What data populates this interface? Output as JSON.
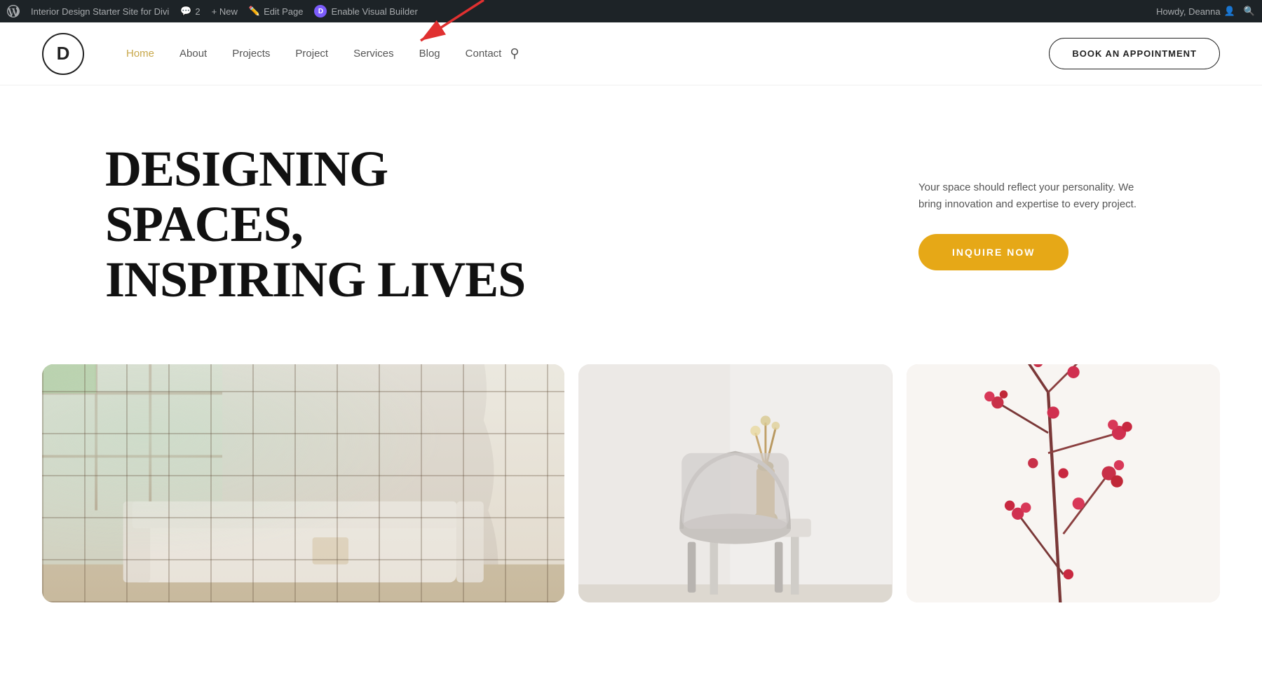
{
  "adminBar": {
    "siteTitle": "Interior Design Starter Site for Divi",
    "commentsCount": "2",
    "newLabel": "+ New",
    "editPageLabel": "Edit Page",
    "enableVisualBuilder": "Enable Visual Builder",
    "howdy": "Howdy, Deanna"
  },
  "nav": {
    "logoLetter": "D",
    "links": [
      {
        "label": "Home",
        "active": true
      },
      {
        "label": "About",
        "active": false
      },
      {
        "label": "Projects",
        "active": false
      },
      {
        "label": "Project",
        "active": false
      },
      {
        "label": "Services",
        "active": false
      },
      {
        "label": "Blog",
        "active": false
      },
      {
        "label": "Contact",
        "active": false
      }
    ],
    "bookButton": "BOOK AN APPOINTMENT"
  },
  "hero": {
    "titleLine1": "DESIGNING SPACES,",
    "titleLine2": "INSPIRING LIVES",
    "subtitle": "Your space should reflect your personality. We bring innovation and expertise to every project.",
    "inquireButton": "INQUIRE NOW"
  },
  "gallery": {
    "images": [
      {
        "alt": "Living room interior with white sofa and large windows"
      },
      {
        "alt": "Chair and side table with vase"
      },
      {
        "alt": "Cherry blossom branch decoration"
      }
    ]
  },
  "colors": {
    "accent": "#e6a817",
    "navActive": "#c8a84b",
    "adminBg": "#1d2327",
    "arrowColor": "#e03030"
  }
}
